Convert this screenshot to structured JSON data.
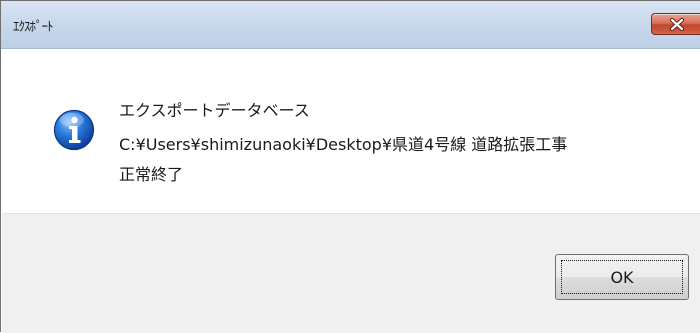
{
  "window": {
    "title": "ｴｸｽﾎﾟｰﾄ",
    "close_icon": "close-icon"
  },
  "message": {
    "icon": "info-icon",
    "line1": "エクスポートデータベース",
    "line2": "C:¥Users¥shimizunaoki¥Desktop¥県道4号線 道路拡張工事",
    "line3": "正常終了"
  },
  "buttons": {
    "ok_label": "OK"
  },
  "colors": {
    "titlebar": "#c9d8ec",
    "close_button": "#c9523a",
    "footer": "#f0f0f0",
    "info_icon": "#1a5fb4"
  }
}
